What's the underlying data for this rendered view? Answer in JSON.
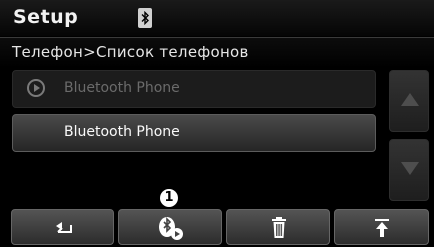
{
  "header": {
    "title": "Setup",
    "status_icon": "bluetooth-icon"
  },
  "breadcrumb": "Телефон>Список телефонов",
  "list": {
    "items": [
      {
        "label": "Bluetooth Phone",
        "icon": "play-circle-icon",
        "state": "inactive"
      },
      {
        "label": "Bluetooth Phone",
        "icon": "",
        "state": "selected"
      }
    ]
  },
  "scrollbar": {
    "up_icon": "arrow-up-icon",
    "down_icon": "arrow-down-icon"
  },
  "toolbar": {
    "buttons": [
      {
        "icon": "back-icon"
      },
      {
        "icon": "bluetooth-connect-icon",
        "badge": "1"
      },
      {
        "icon": "trash-icon"
      },
      {
        "icon": "move-to-top-icon"
      }
    ]
  },
  "colors": {
    "background": "#000000",
    "selected_item": "#3a3a3a",
    "inactive_text": "#6b6b6b"
  }
}
